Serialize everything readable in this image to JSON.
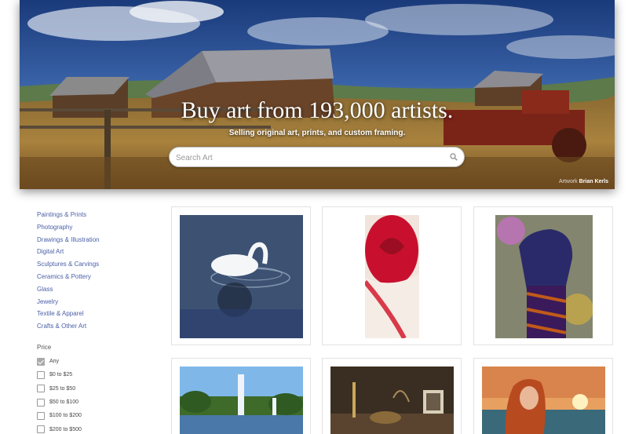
{
  "hero": {
    "title": "Buy art from 193,000 artists.",
    "subtitle": "Selling original art, prints, and custom framing.",
    "search_placeholder": "Search Art",
    "credit_prefix": "Artwork",
    "credit_name": "Brian Kerls"
  },
  "sidebar": {
    "categories": [
      "Paintings & Prints",
      "Photography",
      "Drawings & Illustration",
      "Digital Art",
      "Sculptures & Carvings",
      "Ceramics & Pottery",
      "Glass",
      "Jewelry",
      "Textile & Apparel",
      "Crafts & Other Art"
    ],
    "price_heading": "Price",
    "price_options": [
      {
        "label": "Any",
        "checked": true
      },
      {
        "label": "$0 to $25",
        "checked": false
      },
      {
        "label": "$25 to $50",
        "checked": false
      },
      {
        "label": "$50 to $100",
        "checked": false
      },
      {
        "label": "$100 to $200",
        "checked": false
      },
      {
        "label": "$200 to $500",
        "checked": false
      }
    ]
  },
  "artworks": [
    {
      "name": "swan",
      "icon": "swan-artwork"
    },
    {
      "name": "rose",
      "icon": "rose-artwork"
    },
    {
      "name": "fist",
      "icon": "fist-artwork"
    },
    {
      "name": "fountain",
      "icon": "fountain-artwork"
    },
    {
      "name": "still-life",
      "icon": "still-life-artwork"
    },
    {
      "name": "woman-sunset",
      "icon": "portrait-artwork"
    }
  ],
  "colors": {
    "link": "#4a5fa6",
    "card_border": "#e2e2e2"
  }
}
